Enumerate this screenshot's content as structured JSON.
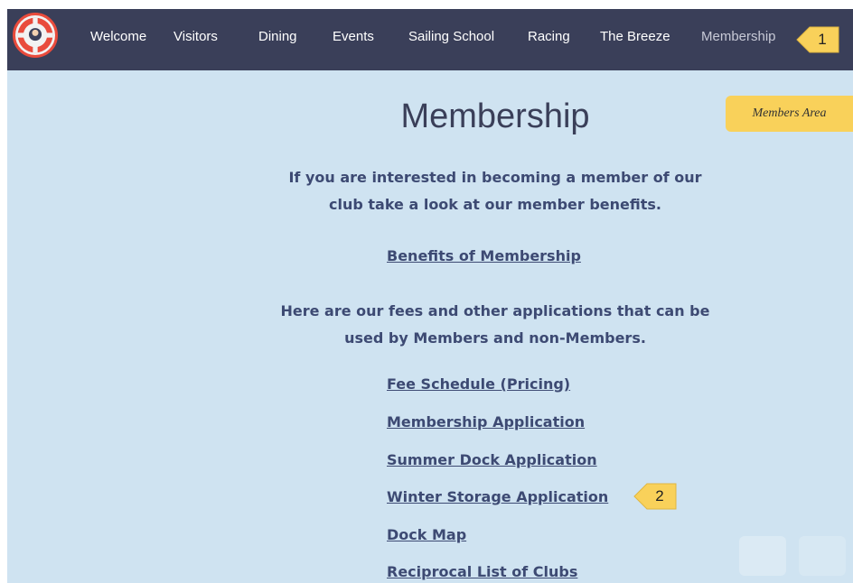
{
  "navbar": {
    "logo_icon": "club-lifebuoy-logo",
    "items": [
      {
        "label": "Welcome"
      },
      {
        "label": "Visitors"
      },
      {
        "label": "Dining"
      },
      {
        "label": "Events"
      },
      {
        "label": "Sailing School"
      },
      {
        "label": "Racing"
      },
      {
        "label": "The Breeze"
      },
      {
        "label": "Membership",
        "active": true
      }
    ]
  },
  "callouts": [
    {
      "number": "1"
    },
    {
      "number": "2"
    }
  ],
  "members_area": {
    "label": "Members Area"
  },
  "main": {
    "title": "Membership",
    "intro_line1": "If you are interested in becoming a member of our",
    "intro_line2": "club take a look at our member benefits.",
    "benefits_link": "Benefits of Membership",
    "fees_line1": "Here are our fees and other applications that can be",
    "fees_line2": "used by Members and non-Members.",
    "links": [
      {
        "label": "Fee Schedule (Pricing)"
      },
      {
        "label": "Membership Application"
      },
      {
        "label": "Summer Dock Application"
      },
      {
        "label": "Winter Storage Application"
      },
      {
        "label": "Dock Map"
      },
      {
        "label": "Reciprocal List of Clubs"
      }
    ]
  },
  "colors": {
    "navbar": "#3a3f59",
    "page_background": "#cfe3f1",
    "text": "#3d4a73",
    "callout": "#f9d15a",
    "members_area": "#f9d15a"
  }
}
